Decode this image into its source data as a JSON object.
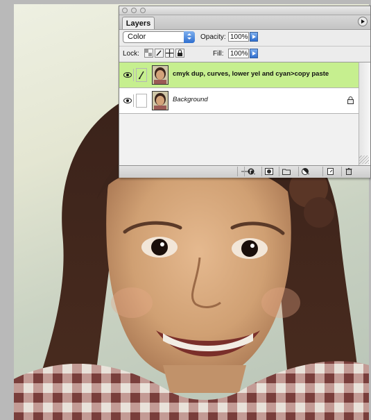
{
  "layers_panel": {
    "tab_label": "Layers",
    "blend_mode": "Color",
    "opacity_label": "Opacity:",
    "opacity_value": "100%",
    "lock_label": "Lock:",
    "fill_label": "Fill:",
    "fill_value": "100%",
    "layers": [
      {
        "name": "cmyk dup, curves, lower yel and cyan>copy paste",
        "selected": true,
        "visible": true,
        "locked": false
      },
      {
        "name": "Background",
        "selected": false,
        "visible": true,
        "locked": true
      }
    ],
    "bottom_buttons": [
      "link-layers-icon",
      "add-style-icon",
      "add-mask-icon",
      "new-group-icon",
      "adjustment-layer-icon",
      "new-layer-icon",
      "trash-icon"
    ]
  },
  "colors": {
    "selected_layer_bg": "#c6ef8f",
    "accent_blue": "#2f6fd0",
    "panel_bg": "#ececec"
  }
}
